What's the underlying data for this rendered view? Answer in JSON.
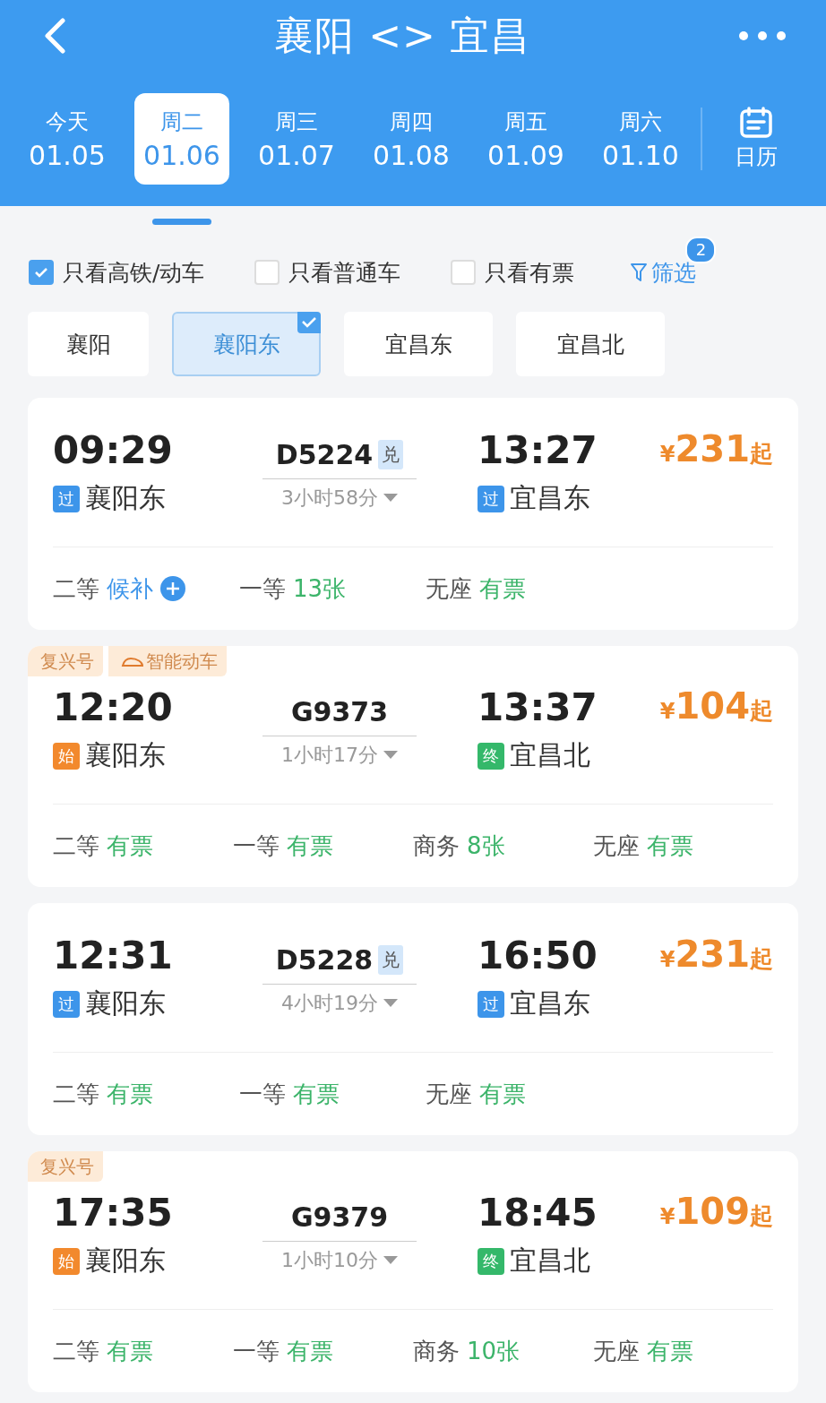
{
  "header": {
    "title": "襄阳 <> 宜昌"
  },
  "dates": [
    {
      "weekday": "今天",
      "date": "01.05",
      "selected": false
    },
    {
      "weekday": "周二",
      "date": "01.06",
      "selected": true
    },
    {
      "weekday": "周三",
      "date": "01.07",
      "selected": false
    },
    {
      "weekday": "周四",
      "date": "01.08",
      "selected": false
    },
    {
      "weekday": "周五",
      "date": "01.09",
      "selected": false
    },
    {
      "weekday": "周六",
      "date": "01.10",
      "selected": false
    }
  ],
  "calendar": {
    "label": "日历"
  },
  "filters": [
    {
      "label": "只看高铁/动车",
      "checked": true
    },
    {
      "label": "只看普通车",
      "checked": false
    },
    {
      "label": "只看有票",
      "checked": false
    }
  ],
  "screen": {
    "label": "筛选",
    "badge": "2"
  },
  "stations": [
    {
      "label": "襄阳",
      "selected": false
    },
    {
      "label": "襄阳东",
      "selected": true
    },
    {
      "label": "宜昌东",
      "selected": false
    },
    {
      "label": "宜昌北",
      "selected": false
    }
  ],
  "trains": [
    {
      "depart": "09:29",
      "depart_station": {
        "marker": "过",
        "kind": "pass",
        "name": "襄阳东"
      },
      "train": "D5224",
      "exchange": "兑",
      "duration": "3小时58分",
      "arrive": "13:27",
      "arrive_station": {
        "marker": "过",
        "kind": "pass",
        "name": "宜昌东"
      },
      "price_symbol": "¥",
      "price": "231",
      "price_suffix": "起",
      "seats": [
        {
          "class": "二等",
          "status": "候补",
          "kind": "waitlist"
        },
        {
          "class": "一等",
          "status": "13张",
          "kind": "available"
        },
        {
          "class": "无座",
          "status": "有票",
          "kind": "available"
        }
      ]
    },
    {
      "tags": [
        {
          "label": "复兴号",
          "kind": "plain"
        },
        {
          "label": "智能动车",
          "kind": "train"
        }
      ],
      "depart": "12:20",
      "depart_station": {
        "marker": "始",
        "kind": "start",
        "name": "襄阳东"
      },
      "train": "G9373",
      "duration": "1小时17分",
      "arrive": "13:37",
      "arrive_station": {
        "marker": "终",
        "kind": "end",
        "name": "宜昌北"
      },
      "price_symbol": "¥",
      "price": "104",
      "price_suffix": "起",
      "seats": [
        {
          "class": "二等",
          "status": "有票",
          "kind": "available"
        },
        {
          "class": "一等",
          "status": "有票",
          "kind": "available"
        },
        {
          "class": "商务",
          "status": "8张",
          "kind": "available"
        },
        {
          "class": "无座",
          "status": "有票",
          "kind": "available"
        }
      ]
    },
    {
      "depart": "12:31",
      "depart_station": {
        "marker": "过",
        "kind": "pass",
        "name": "襄阳东"
      },
      "train": "D5228",
      "exchange": "兑",
      "duration": "4小时19分",
      "arrive": "16:50",
      "arrive_station": {
        "marker": "过",
        "kind": "pass",
        "name": "宜昌东"
      },
      "price_symbol": "¥",
      "price": "231",
      "price_suffix": "起",
      "seats": [
        {
          "class": "二等",
          "status": "有票",
          "kind": "available"
        },
        {
          "class": "一等",
          "status": "有票",
          "kind": "available"
        },
        {
          "class": "无座",
          "status": "有票",
          "kind": "available"
        }
      ]
    },
    {
      "tags": [
        {
          "label": "复兴号",
          "kind": "plain"
        }
      ],
      "depart": "17:35",
      "depart_station": {
        "marker": "始",
        "kind": "start",
        "name": "襄阳东"
      },
      "train": "G9379",
      "duration": "1小时10分",
      "arrive": "18:45",
      "arrive_station": {
        "marker": "终",
        "kind": "end",
        "name": "宜昌北"
      },
      "price_symbol": "¥",
      "price": "109",
      "price_suffix": "起",
      "seats": [
        {
          "class": "二等",
          "status": "有票",
          "kind": "available"
        },
        {
          "class": "一等",
          "status": "有票",
          "kind": "available"
        },
        {
          "class": "商务",
          "status": "10张",
          "kind": "available"
        },
        {
          "class": "无座",
          "status": "有票",
          "kind": "available"
        }
      ]
    }
  ]
}
